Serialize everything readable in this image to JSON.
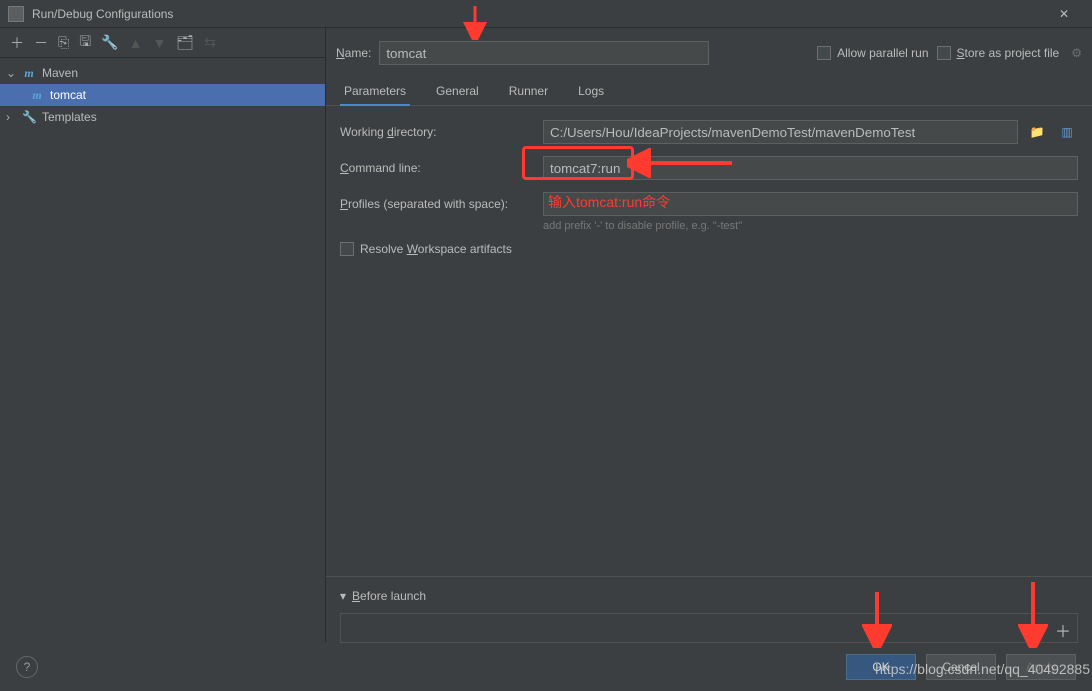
{
  "window": {
    "title": "Run/Debug Configurations"
  },
  "toolbar": {
    "items": [
      "add",
      "remove",
      "copy",
      "save",
      "wrench",
      "sep",
      "up",
      "down",
      "sep",
      "folder",
      "toggle"
    ]
  },
  "tree": {
    "maven_label": "Maven",
    "tomcat_label": "tomcat",
    "templates_label": "Templates"
  },
  "header": {
    "name_label": "Name:",
    "name_value": "tomcat",
    "allow_parallel": "Allow parallel run",
    "store_as_project": "Store as project file"
  },
  "tabs": {
    "parameters": "Parameters",
    "general": "General",
    "runner": "Runner",
    "logs": "Logs"
  },
  "form": {
    "workdir_label": "Working directory:",
    "workdir_value": "C:/Users/Hou/IdeaProjects/mavenDemoTest/mavenDemoTest",
    "cmdline_label": "Command line:",
    "cmdline_value": "tomcat7:run",
    "profiles_label": "Profiles (separated with space):",
    "profiles_value": "",
    "profiles_hint": "add prefix '-' to disable profile, e.g. \"-test\"",
    "resolve_label": "Resolve Workspace artifacts"
  },
  "before_launch": {
    "label": "Before launch"
  },
  "buttons": {
    "ok": "OK",
    "cancel": "Cancel",
    "apply": "Apply"
  },
  "annotations": {
    "cmd_text": "输入tomcat:run命令"
  },
  "watermark": "https://blog.csdn.net/qq_40492885"
}
